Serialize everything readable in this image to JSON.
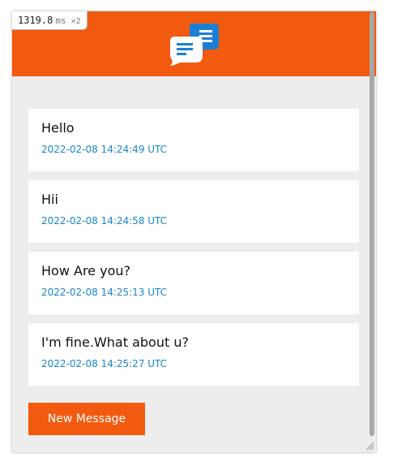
{
  "perf_badge": {
    "value": "1319.8",
    "unit": "ms",
    "multiplier": "×2"
  },
  "header": {
    "logo_icon": "chat-bubbles-icon",
    "background_color": "#f25a0f"
  },
  "messages": [
    {
      "text": "Hello",
      "timestamp": "2022-02-08 14:24:49 UTC"
    },
    {
      "text": "Hii",
      "timestamp": "2022-02-08 14:24:58 UTC"
    },
    {
      "text": "How Are you?",
      "timestamp": "2022-02-08 14:25:13 UTC"
    },
    {
      "text": "I'm fine.What about u?",
      "timestamp": "2022-02-08 14:25:27 UTC"
    }
  ],
  "new_message_button": {
    "label": "New Message"
  },
  "colors": {
    "accent": "#f25a0f",
    "timestamp": "#1a86c8",
    "logo_blue": "#1a7fd4"
  }
}
